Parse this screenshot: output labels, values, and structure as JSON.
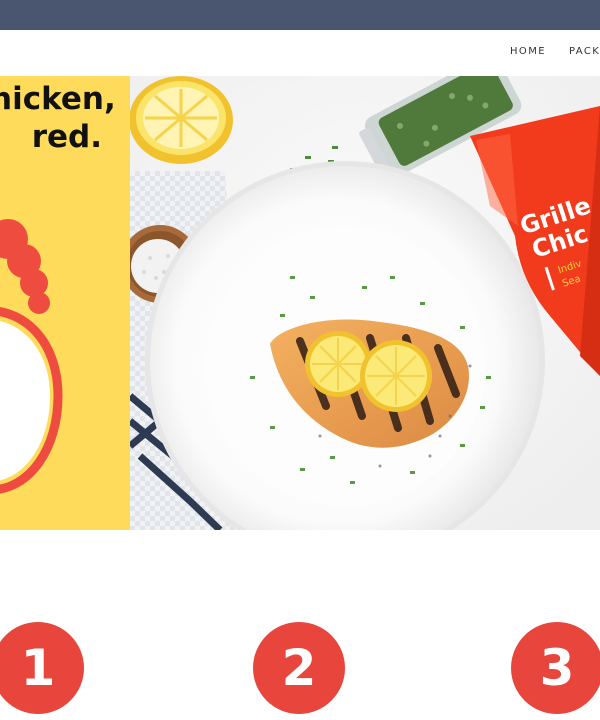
{
  "nav": {
    "home": "HOME",
    "packages": "PACK"
  },
  "hero": {
    "headline_line1": "hicken,",
    "headline_line2": "red.",
    "bag_label_line1": "Grille",
    "bag_label_line2": "Chic",
    "bag_sub_line1": "Indiv",
    "bag_sub_line2": "Sea"
  },
  "steps": [
    "1",
    "2",
    "3"
  ],
  "colors": {
    "top_bar": "#4a5570",
    "yellow_panel": "#fedb5a",
    "accent_red": "#e8453c",
    "bag_orange": "#f23a1c"
  }
}
